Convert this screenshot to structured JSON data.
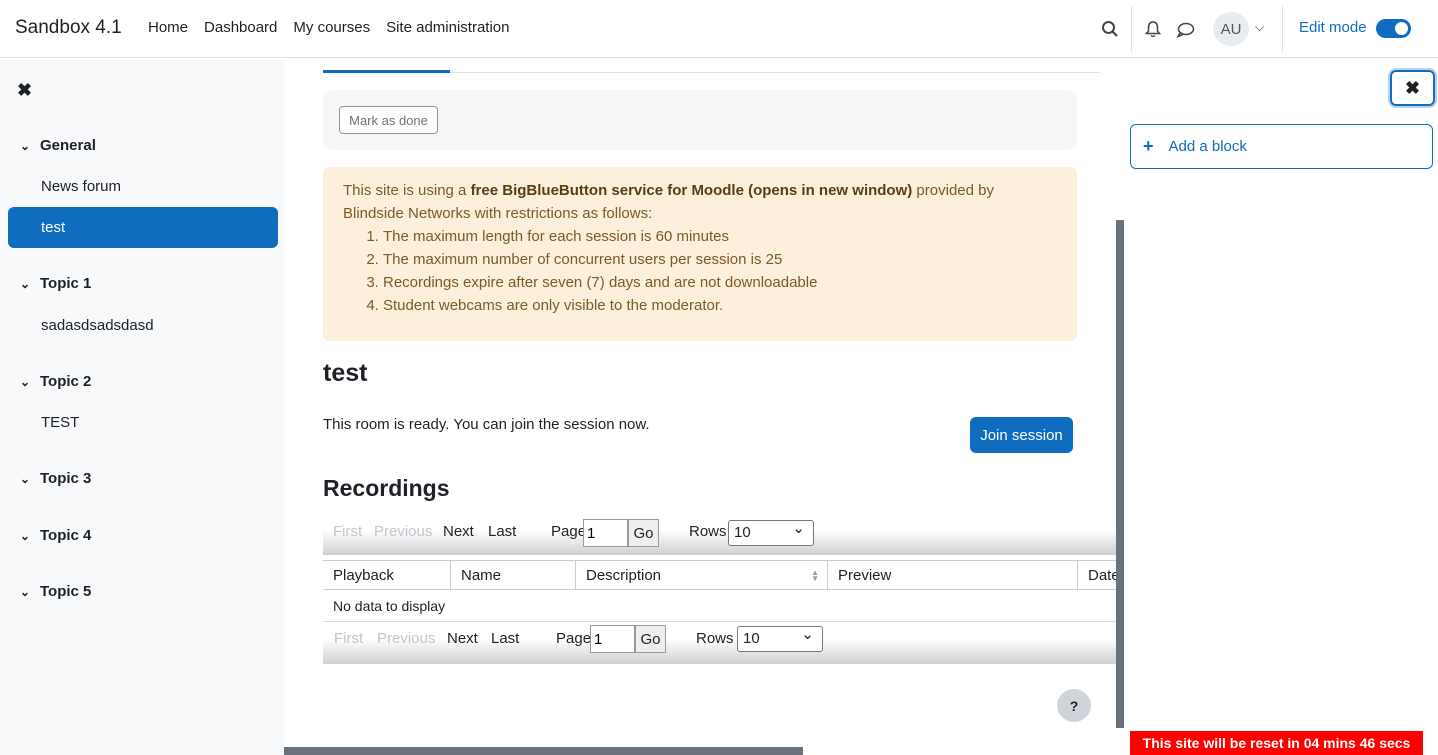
{
  "navbar": {
    "brand": "Sandbox 4.1",
    "links": [
      "Home",
      "Dashboard",
      "My courses",
      "Site administration"
    ],
    "avatar_initials": "AU",
    "edit_mode_label": "Edit mode",
    "edit_mode_on": true
  },
  "course_index": {
    "close_icon": "close-icon",
    "sections": [
      {
        "title": "General",
        "items": [
          "News forum",
          "test"
        ]
      },
      {
        "title": "Topic 1",
        "items": [
          "sadasdsadsdasd"
        ]
      },
      {
        "title": "Topic 2",
        "items": [
          "TEST"
        ]
      },
      {
        "title": "Topic 3",
        "items": []
      },
      {
        "title": "Topic 4",
        "items": []
      },
      {
        "title": "Topic 5",
        "items": []
      }
    ],
    "active_item": "test"
  },
  "activity": {
    "mark_done_label": "Mark as done",
    "notice": {
      "prefix": "This site is using a ",
      "link_text": "free BigBlueButton service for Moodle (opens in new window)",
      "suffix": " provided by Blindside Networks with restrictions as follows:",
      "restrictions": [
        "The maximum length for each session is 60 minutes",
        "The maximum number of concurrent users per session is 25",
        "Recordings expire after seven (7) days and are not downloadable",
        "Student webcams are only visible to the moderator."
      ]
    },
    "room_title": "test",
    "room_status": "This room is ready. You can join the session now.",
    "join_button": "Join session",
    "recordings_title": "Recordings",
    "pager": {
      "first": "First",
      "previous": "Previous",
      "next": "Next",
      "last": "Last",
      "page_label": "Page",
      "page_value": "1",
      "go": "Go",
      "rows_label": "Rows",
      "rows_value": "10"
    },
    "table": {
      "columns": [
        "Playback",
        "Name",
        "Description",
        "Preview",
        "Date"
      ],
      "empty_message": "No data to display"
    },
    "help_label": "?"
  },
  "block_drawer": {
    "add_block_label": "Add a block"
  },
  "reset_banner": "This site will be reset in 04 mins 46 secs",
  "colors": {
    "primary": "#0f6cbf",
    "alert_bg": "#fcefdc",
    "banner": "#ff0000"
  }
}
